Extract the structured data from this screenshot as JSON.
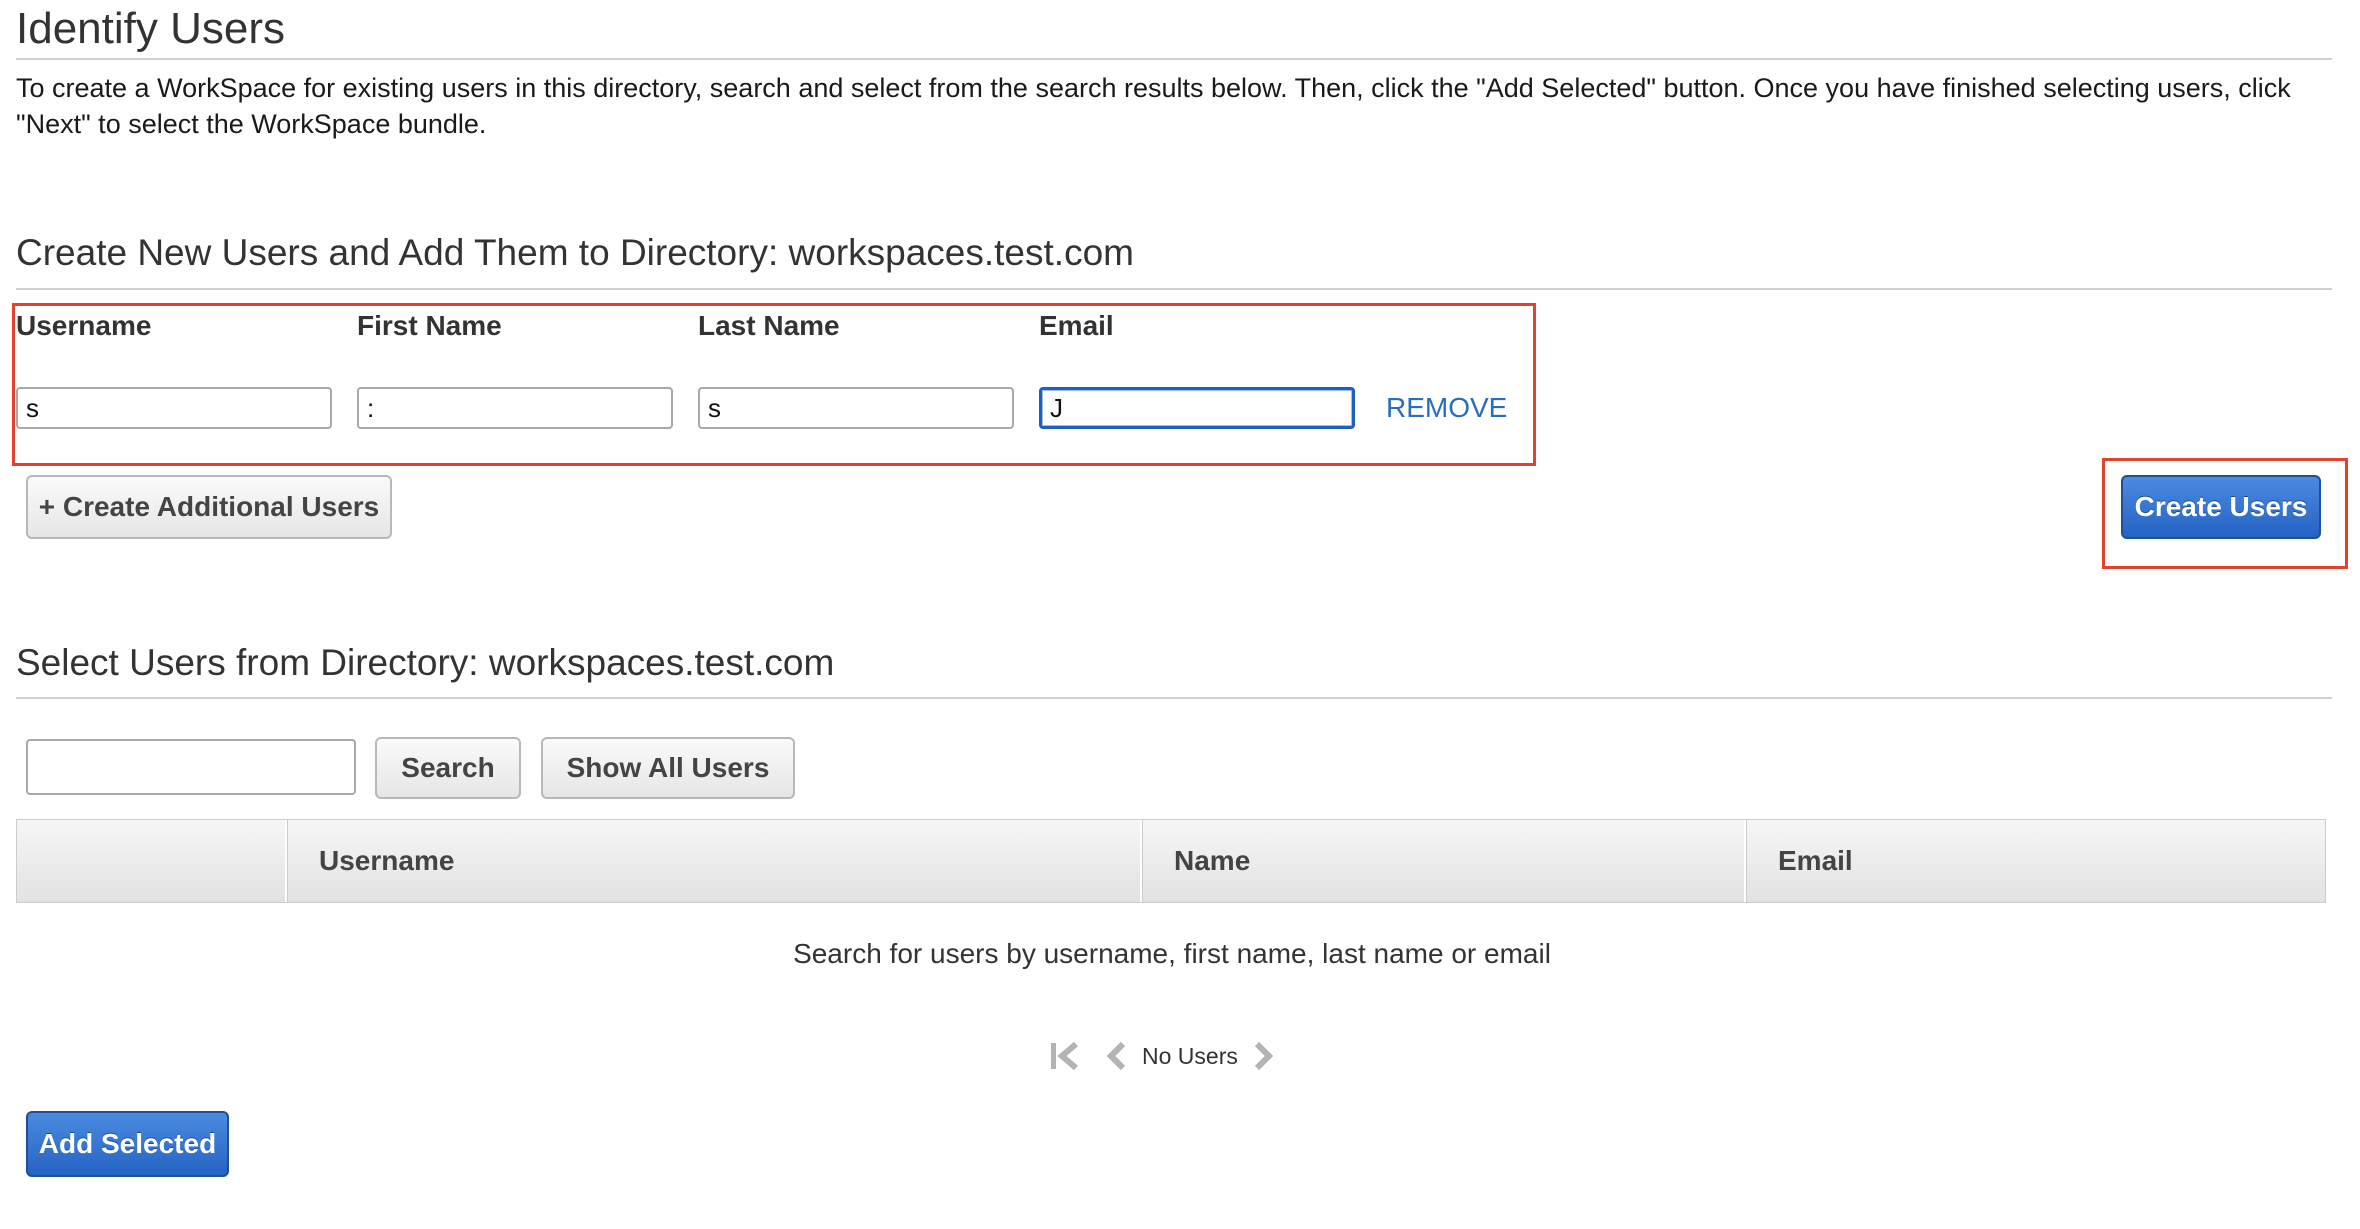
{
  "header": {
    "title": "Identify Users",
    "intro": "To create a WorkSpace for existing users in this directory, search and select from the search results below. Then, click the \"Add Selected\" button. Once you have finished selecting users, click \"Next\" to select the WorkSpace bundle."
  },
  "create_section": {
    "title": "Create New Users and Add Them to Directory: workspaces.test.com",
    "columns": {
      "username": "Username",
      "first_name": "First Name",
      "last_name": "Last Name",
      "email": "Email"
    },
    "row": {
      "username_value": "s",
      "first_name_value": ":",
      "last_name_value": "s",
      "email_value": "J"
    },
    "remove_label": "REMOVE",
    "add_more_label": "+ Create Additional Users",
    "create_label": "Create Users"
  },
  "select_section": {
    "title": "Select Users from Directory: workspaces.test.com",
    "search_placeholder": "",
    "search_label": "Search",
    "show_all_label": "Show All Users",
    "table_headers": [
      "",
      "Username",
      "Name",
      "Email"
    ],
    "empty_message": "Search for users by username, first name, last name or email",
    "pager_text": "No Users",
    "add_selected_label": "Add Selected"
  },
  "icons": {
    "first_page": "first-page-icon",
    "prev_page": "chevron-left-icon",
    "next_page": "chevron-right-icon"
  },
  "colors": {
    "highlight": "#e0432f",
    "primary": "#2563c4",
    "link": "#2a6ebb"
  }
}
